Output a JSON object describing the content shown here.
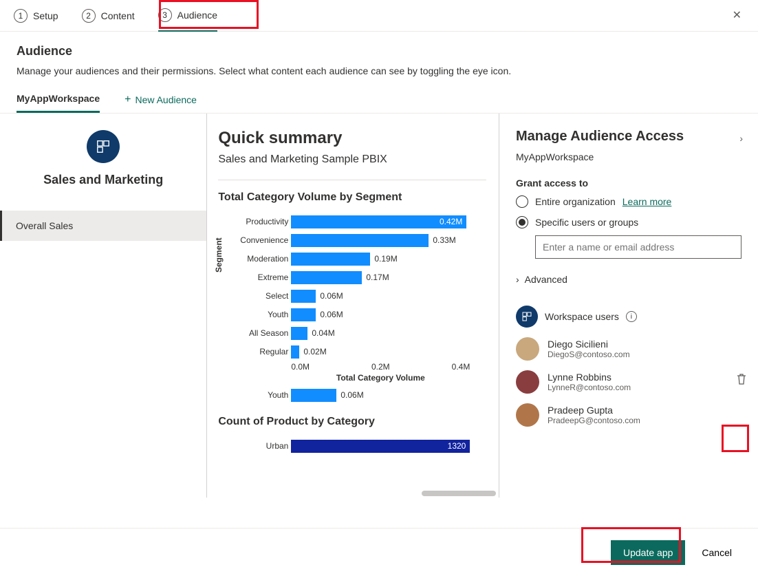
{
  "steps": [
    {
      "num": "1",
      "label": "Setup"
    },
    {
      "num": "2",
      "label": "Content"
    },
    {
      "num": "3",
      "label": "Audience"
    }
  ],
  "close_label": "✕",
  "page_title": "Audience",
  "page_subtitle": "Manage your audiences and their permissions. Select what content each audience can see by toggling the eye icon.",
  "audience_tabs": {
    "active": "MyAppWorkspace",
    "new_label": "New Audience"
  },
  "left": {
    "workspace_title": "Sales and Marketing",
    "nav_item": "Overall Sales"
  },
  "preview": {
    "title": "Quick summary",
    "subtitle": "Sales and Marketing Sample PBIX"
  },
  "chart_data": [
    {
      "type": "bar",
      "orientation": "horizontal",
      "title": "Total Category Volume by Segment",
      "ylabel": "Segment",
      "xlabel": "Total Category Volume",
      "xlim": [
        0.0,
        0.4
      ],
      "xticks": [
        "0.0M",
        "0.2M",
        "0.4M"
      ],
      "categories": [
        "Productivity",
        "Convenience",
        "Moderation",
        "Extreme",
        "Select",
        "Youth",
        "All Season",
        "Regular"
      ],
      "values": [
        0.42,
        0.33,
        0.19,
        0.17,
        0.06,
        0.06,
        0.04,
        0.02
      ],
      "value_labels": [
        "0.42M",
        "0.33M",
        "0.19M",
        "0.17M",
        "0.06M",
        "0.06M",
        "0.04M",
        "0.02M"
      ],
      "extra_row": {
        "category": "Youth",
        "value": 0.06,
        "value_label": "0.06M"
      }
    },
    {
      "type": "bar",
      "orientation": "horizontal",
      "title": "Count of Product by Category",
      "categories": [
        "Urban"
      ],
      "values": [
        1320
      ],
      "value_labels": [
        "1320"
      ]
    }
  ],
  "right": {
    "title": "Manage Audience Access",
    "subtitle": "MyAppWorkspace",
    "grant_label": "Grant access to",
    "option_org": "Entire organization",
    "learn_more": "Learn more",
    "option_specific": "Specific users or groups",
    "input_placeholder": "Enter a name or email address",
    "advanced_label": "Advanced",
    "ws_users_label": "Workspace users",
    "users": [
      {
        "name": "Diego Sicilieni",
        "email": "DiegoS@contoso.com",
        "avatar_color": "#c9a87d"
      },
      {
        "name": "Lynne Robbins",
        "email": "LynneR@contoso.com",
        "avatar_color": "#8a3d3f"
      },
      {
        "name": "Pradeep Gupta",
        "email": "PradeepG@contoso.com",
        "avatar_color": "#b0764a"
      }
    ]
  },
  "footer": {
    "primary": "Update app",
    "cancel": "Cancel"
  }
}
